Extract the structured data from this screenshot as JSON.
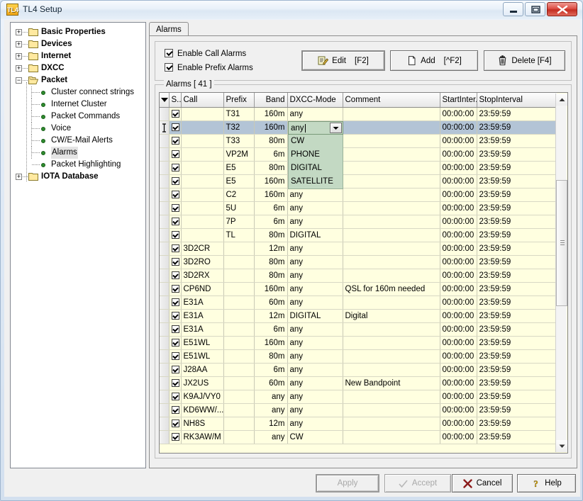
{
  "window": {
    "title": "TL4 Setup",
    "icon_label": "TL4",
    "controls": {
      "minimize": "minimize-button",
      "maximize": "maximize-button",
      "close": "close-button"
    }
  },
  "tree": {
    "folders": [
      {
        "label": "Basic Properties",
        "expander": "+",
        "expanded": false
      },
      {
        "label": "Devices",
        "expander": "+",
        "expanded": false
      },
      {
        "label": "Internet",
        "expander": "+",
        "expanded": false
      },
      {
        "label": "DXCC",
        "expander": "+",
        "expanded": false
      },
      {
        "label": "Packet",
        "expander": "−",
        "expanded": true
      }
    ],
    "packet_children": [
      {
        "label": "Cluster connect strings",
        "selected": false
      },
      {
        "label": "Internet Cluster",
        "selected": false
      },
      {
        "label": "Packet Commands",
        "selected": false
      },
      {
        "label": "Voice",
        "selected": false
      },
      {
        "label": "CW/E-Mail Alerts",
        "selected": false
      },
      {
        "label": "Alarms",
        "selected": true
      },
      {
        "label": "Packet Highlighting",
        "selected": false
      }
    ],
    "last_folder": {
      "label": "IOTA Database",
      "expander": "+",
      "expanded": false
    }
  },
  "tabs": [
    {
      "label": "Alarms",
      "active": true
    }
  ],
  "options": {
    "enable_call_alarms": {
      "label": "Enable Call Alarms",
      "checked": true
    },
    "enable_prefix_alarms": {
      "label": "Enable Prefix Alarms",
      "checked": true
    }
  },
  "toolbar": {
    "edit": {
      "label": "Edit",
      "shortcut": "[F2]",
      "icon": "edit-icon"
    },
    "add": {
      "label": "Add",
      "shortcut": "[^F2]",
      "icon": "page-icon"
    },
    "delete": {
      "label": "Delete [F4]",
      "icon": "trash-icon"
    }
  },
  "grid": {
    "legend": "Alarms [ 41 ]",
    "columns": [
      "",
      "S...",
      "Call",
      "Prefix",
      "Band",
      "DXCC-Mode",
      "Comment",
      "StartInter...",
      "StopInterval"
    ],
    "rows": [
      {
        "checked": true,
        "call": "",
        "prefix": "T31",
        "band": "160m",
        "mode": "any",
        "comment": "",
        "start": "00:00:00",
        "stop": "23:59:59",
        "selected": false
      },
      {
        "checked": true,
        "call": "",
        "prefix": "T32",
        "band": "160m",
        "mode": "any",
        "comment": "",
        "start": "00:00:00",
        "stop": "23:59:59",
        "selected": true
      },
      {
        "checked": true,
        "call": "",
        "prefix": "T33",
        "band": "80m",
        "mode": "",
        "comment": "",
        "start": "00:00:00",
        "stop": "23:59:59",
        "selected": false
      },
      {
        "checked": true,
        "call": "",
        "prefix": "VP2M",
        "band": "6m",
        "mode": "",
        "comment": "",
        "start": "00:00:00",
        "stop": "23:59:59",
        "selected": false
      },
      {
        "checked": true,
        "call": "",
        "prefix": "E5",
        "band": "80m",
        "mode": "",
        "comment": "",
        "start": "00:00:00",
        "stop": "23:59:59",
        "selected": false
      },
      {
        "checked": true,
        "call": "",
        "prefix": "E5",
        "band": "160m",
        "mode": "",
        "comment": "",
        "start": "00:00:00",
        "stop": "23:59:59",
        "selected": false
      },
      {
        "checked": true,
        "call": "",
        "prefix": "C2",
        "band": "160m",
        "mode": "any",
        "comment": "",
        "start": "00:00:00",
        "stop": "23:59:59",
        "selected": false
      },
      {
        "checked": true,
        "call": "",
        "prefix": "5U",
        "band": "6m",
        "mode": "any",
        "comment": "",
        "start": "00:00:00",
        "stop": "23:59:59",
        "selected": false
      },
      {
        "checked": true,
        "call": "",
        "prefix": "7P",
        "band": "6m",
        "mode": "any",
        "comment": "",
        "start": "00:00:00",
        "stop": "23:59:59",
        "selected": false
      },
      {
        "checked": true,
        "call": "",
        "prefix": "TL",
        "band": "80m",
        "mode": "DIGITAL",
        "comment": "",
        "start": "00:00:00",
        "stop": "23:59:59",
        "selected": false
      },
      {
        "checked": true,
        "call": "3D2CR",
        "prefix": "",
        "band": "12m",
        "mode": "any",
        "comment": "",
        "start": "00:00:00",
        "stop": "23:59:59",
        "selected": false
      },
      {
        "checked": true,
        "call": "3D2RO",
        "prefix": "",
        "band": "80m",
        "mode": "any",
        "comment": "",
        "start": "00:00:00",
        "stop": "23:59:59",
        "selected": false
      },
      {
        "checked": true,
        "call": "3D2RX",
        "prefix": "",
        "band": "80m",
        "mode": "any",
        "comment": "",
        "start": "00:00:00",
        "stop": "23:59:59",
        "selected": false
      },
      {
        "checked": true,
        "call": "CP6ND",
        "prefix": "",
        "band": "160m",
        "mode": "any",
        "comment": "QSL for 160m needed",
        "start": "00:00:00",
        "stop": "23:59:59",
        "selected": false
      },
      {
        "checked": true,
        "call": "E31A",
        "prefix": "",
        "band": "60m",
        "mode": "any",
        "comment": "",
        "start": "00:00:00",
        "stop": "23:59:59",
        "selected": false
      },
      {
        "checked": true,
        "call": "E31A",
        "prefix": "",
        "band": "12m",
        "mode": "DIGITAL",
        "comment": "Digital",
        "start": "00:00:00",
        "stop": "23:59:59",
        "selected": false
      },
      {
        "checked": true,
        "call": "E31A",
        "prefix": "",
        "band": "6m",
        "mode": "any",
        "comment": "",
        "start": "00:00:00",
        "stop": "23:59:59",
        "selected": false
      },
      {
        "checked": true,
        "call": "E51WL",
        "prefix": "",
        "band": "160m",
        "mode": "any",
        "comment": "",
        "start": "00:00:00",
        "stop": "23:59:59",
        "selected": false
      },
      {
        "checked": true,
        "call": "E51WL",
        "prefix": "",
        "band": "80m",
        "mode": "any",
        "comment": "",
        "start": "00:00:00",
        "stop": "23:59:59",
        "selected": false
      },
      {
        "checked": true,
        "call": "J28AA",
        "prefix": "",
        "band": "6m",
        "mode": "any",
        "comment": "",
        "start": "00:00:00",
        "stop": "23:59:59",
        "selected": false
      },
      {
        "checked": true,
        "call": "JX2US",
        "prefix": "",
        "band": "60m",
        "mode": "any",
        "comment": "New Bandpoint",
        "start": "00:00:00",
        "stop": "23:59:59",
        "selected": false
      },
      {
        "checked": true,
        "call": "K9AJ/VY0",
        "prefix": "",
        "band": "any",
        "mode": "any",
        "comment": "",
        "start": "00:00:00",
        "stop": "23:59:59",
        "selected": false
      },
      {
        "checked": true,
        "call": "KD6WW/...",
        "prefix": "",
        "band": "any",
        "mode": "any",
        "comment": "",
        "start": "00:00:00",
        "stop": "23:59:59",
        "selected": false
      },
      {
        "checked": true,
        "call": "NH8S",
        "prefix": "",
        "band": "12m",
        "mode": "any",
        "comment": "",
        "start": "00:00:00",
        "stop": "23:59:59",
        "selected": false
      },
      {
        "checked": true,
        "call": "RK3AW/M",
        "prefix": "",
        "band": "any",
        "mode": "CW",
        "comment": "",
        "start": "00:00:00",
        "stop": "23:59:59",
        "selected": false
      }
    ]
  },
  "dropdown": {
    "open": true,
    "row_index": 1,
    "value": "any",
    "options": [
      "CW",
      "PHONE",
      "DIGITAL",
      "SATELLITE"
    ]
  },
  "footer": {
    "apply": {
      "label": "Apply",
      "enabled": false
    },
    "accept": {
      "label": "Accept",
      "enabled": false,
      "icon": "check-icon"
    },
    "cancel": {
      "label": "Cancel",
      "icon": "x-icon"
    },
    "help": {
      "label": "Help",
      "icon": "question-icon"
    }
  },
  "colors": {
    "row_background": "#ffffe0",
    "selected_row": "#b3c4d6",
    "dropdown_background": "#c3d9c3",
    "accent_close": "#c32d22"
  }
}
